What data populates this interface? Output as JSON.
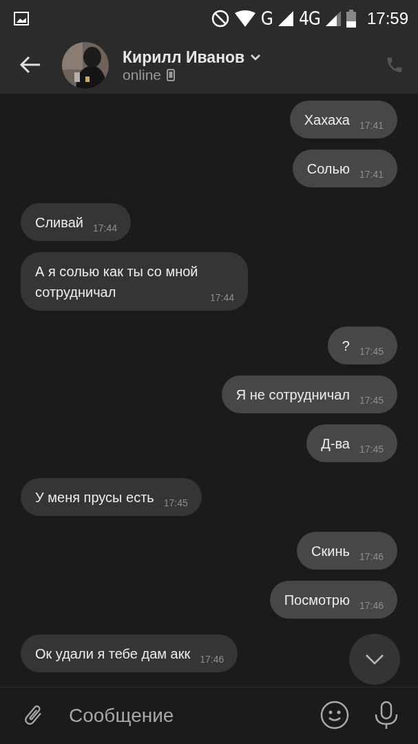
{
  "status_bar": {
    "network": "G",
    "network_2": "4G",
    "time": "17:59"
  },
  "header": {
    "name": "Кирилл Иванов",
    "status": "online"
  },
  "messages": [
    {
      "text": "Хахаха",
      "time": "17:41",
      "outgoing": true
    },
    {
      "text": "Солью",
      "time": "17:41",
      "outgoing": true
    },
    {
      "text": "Сливай",
      "time": "17:44",
      "outgoing": false
    },
    {
      "text": "А я солью как ты со мной сотрудничал",
      "time": "17:44",
      "outgoing": false
    },
    {
      "text": "?",
      "time": "17:45",
      "outgoing": true
    },
    {
      "text": "Я не сотрудничал",
      "time": "17:45",
      "outgoing": true
    },
    {
      "text": "Д-ва",
      "time": "17:45",
      "outgoing": true
    },
    {
      "text": "У меня прусы есть",
      "time": "17:45",
      "outgoing": false
    },
    {
      "text": "Скинь",
      "time": "17:46",
      "outgoing": true
    },
    {
      "text": "Посмотрю",
      "time": "17:46",
      "outgoing": true
    },
    {
      "text": "Ок удали я тебе дам акк",
      "time": "17:46",
      "outgoing": false
    }
  ],
  "composer": {
    "placeholder": "Сообщение"
  }
}
